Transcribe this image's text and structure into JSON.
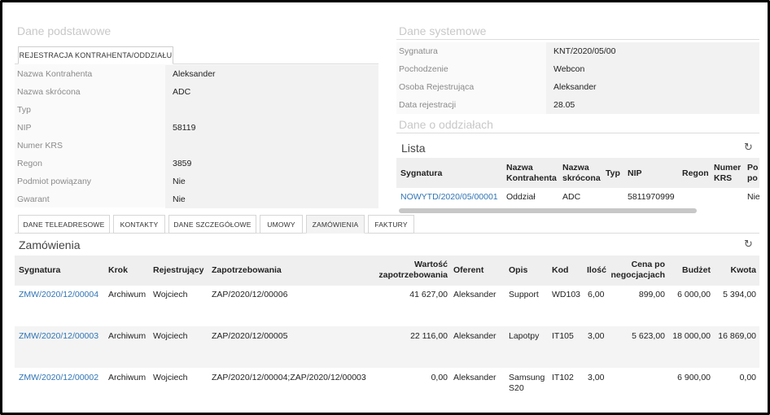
{
  "basic": {
    "section_title": "Dane podstawowe",
    "tab_label": "REJESTRACJA KONTRAHENTA/ODDZIAŁU",
    "fields": [
      {
        "label": "Nazwa Kontrahenta",
        "value": "Aleksander"
      },
      {
        "label": "Nazwa skrócona",
        "value": "ADC"
      },
      {
        "label": "Typ",
        "value": ""
      },
      {
        "label": "NIP",
        "value": "58119"
      },
      {
        "label": "Numer KRS",
        "value": ""
      },
      {
        "label": "Regon",
        "value": "3859"
      },
      {
        "label": "Podmiot powiązany",
        "value": "Nie"
      },
      {
        "label": "Gwarant",
        "value": "Nie"
      }
    ]
  },
  "system": {
    "section_title": "Dane systemowe",
    "fields": [
      {
        "label": "Sygnatura",
        "value": "KNT/2020/05/00"
      },
      {
        "label": "Pochodzenie",
        "value": "Webcon"
      },
      {
        "label": "Osoba Rejestrująca",
        "value": "Aleksander"
      },
      {
        "label": "Data rejestracji",
        "value": "28.05"
      }
    ]
  },
  "branches": {
    "section_title": "Dane o oddziałach",
    "list_title": "Lista",
    "columns": [
      "Sygnatura",
      "Nazwa Kontrahenta",
      "Nazwa skrócona",
      "Typ",
      "NIP",
      "Regon",
      "Numer KRS",
      "Po po"
    ],
    "rows": [
      {
        "sygnatura": "NOWYTD/2020/05/00001",
        "nazwa": "Oddział",
        "skrocona": "ADC",
        "typ": "",
        "nip": "5811970999",
        "regon": "",
        "krs": "",
        "po": "Nie"
      }
    ]
  },
  "tabs": [
    {
      "label": "DANE TELEADRESOWE",
      "active": false
    },
    {
      "label": "KONTAKTY",
      "active": false
    },
    {
      "label": "DANE SZCZEGÓŁOWE",
      "active": false
    },
    {
      "label": "UMOWY",
      "active": false
    },
    {
      "label": "ZAMÓWIENIA",
      "active": true
    },
    {
      "label": "FAKTURY",
      "active": false
    }
  ],
  "orders": {
    "title": "Zamówienia",
    "columns": [
      "Sygnatura",
      "Krok",
      "Rejestrujący",
      "Zapotrzebowania",
      "Wartość zapotrzebowania",
      "Oferent",
      "Opis",
      "Kod",
      "Ilość",
      "Cena po negocjacjach",
      "Budżet",
      "Kwota"
    ],
    "rows": [
      {
        "sygnatura": "ZMW/2020/12/00004",
        "krok": "Archiwum",
        "rejestrujacy": "Wojciech",
        "zapotrzebowania": "ZAP/2020/12/00006",
        "wartosc": "41 627,00",
        "oferent": "Aleksander",
        "opis": "Support",
        "opis2": "",
        "kod": "WD103",
        "ilosc": "6,00",
        "cena": "899,00",
        "budzet": "6 000,00",
        "kwota": "5 394,00"
      },
      {
        "sygnatura": "ZMW/2020/12/00003",
        "krok": "Archiwum",
        "rejestrujacy": "Wojciech",
        "zapotrzebowania": "ZAP/2020/12/00005",
        "wartosc": "22 116,00",
        "oferent": "Aleksander",
        "opis": "Lapotpy",
        "opis2": "",
        "kod": "IT105",
        "ilosc": "3,00",
        "cena": "5 623,00",
        "budzet": "18 000,00",
        "kwota": "16 869,00"
      },
      {
        "sygnatura": "ZMW/2020/12/00002",
        "krok": "Archiwum",
        "rejestrujacy": "Wojciech",
        "zapotrzebowania": "ZAP/2020/12/00004;ZAP/2020/12/00003",
        "wartosc": "0,00",
        "oferent": "Aleksander",
        "opis": "Samsung",
        "opis2": "S20",
        "kod": "IT102",
        "ilosc": "3,00",
        "cena": "",
        "budzet": "6 900,00",
        "kwota": "0,00"
      }
    ]
  },
  "icons": {
    "refresh": "refresh-icon"
  },
  "colors": {
    "link": "#2f74b5",
    "section_title": "#c8c8c8",
    "header_bg": "#efefef"
  }
}
